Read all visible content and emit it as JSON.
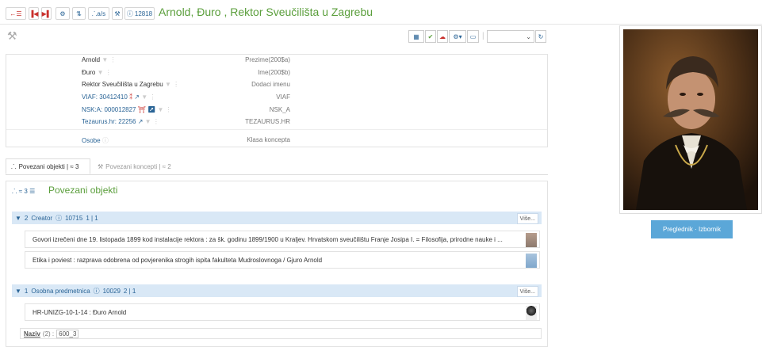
{
  "header": {
    "title": "Arnold, Đuro , Rektor Sveučilišta u Zagrebu",
    "buttons": {
      "back": "←☰",
      "first": "⏮",
      "last": "⏭",
      "settings": "⚙",
      "sort": "⇅",
      "tree": "⸫a/s",
      "tool": "🔨",
      "id": "12818"
    }
  },
  "toolbar": {
    "select_value": ""
  },
  "record": {
    "fields": [
      {
        "label": "Prezime(200$a)",
        "value": "Arnold"
      },
      {
        "label": "Ime(200$b)",
        "value": "Đuro"
      },
      {
        "label": "Dodaci imenu",
        "value": "Rektor Sveučilišta u Zagrebu"
      },
      {
        "label": "VIAF",
        "value": "VIAF: 30412410"
      },
      {
        "label": "NSK_A",
        "value": "NSK:A: 000012827"
      },
      {
        "label": "TEZAURUS.HR",
        "value": "Tezaurus.hr: 22256"
      }
    ],
    "concept": {
      "label": "Klasa koncepta",
      "value": "Osobe"
    }
  },
  "tabs": [
    {
      "label": "Povezani objekti | ≈ 3"
    },
    {
      "label": "Povezani koncepti | ≈ 2"
    }
  ],
  "section": {
    "badge": "≈ 3",
    "title": "Povezani objekti"
  },
  "groups": [
    {
      "count": "2",
      "name": "Creator",
      "id": "10715",
      "pages": "1 | 1",
      "more": "Više...",
      "items": [
        "Govori izrečeni dne 19. listopada 1899 kod instalacije rektora : za šk. godinu 1899/1900 u Kraljev. Hrvatskom sveučilištu Franje Josipa I. = Filosofija, prirodne nauke i ...",
        "Etika i poviest : razprava odobrena od povjerenika strogih ispita fakulteta Mudroslovnoga / Gjuro Arnold"
      ]
    },
    {
      "count": "1",
      "name": "Osobna predmetnica",
      "id": "10029",
      "pages": "2 | 1",
      "more": "Više...",
      "items": [
        "HR-UNIZG-10-1-14 : Đuro Arnold"
      ]
    }
  ],
  "footer": {
    "naziv_label": "Naziv",
    "naziv_count": "(2) :",
    "naziv_value": "600_3"
  },
  "sidebar": {
    "button": "Preglednik · Izbornik"
  },
  "colors": {
    "accent_green": "#5a9e3b",
    "link_blue": "#2a6496",
    "group_bg": "#d9e8f6",
    "button_blue": "#5ba7d8"
  }
}
